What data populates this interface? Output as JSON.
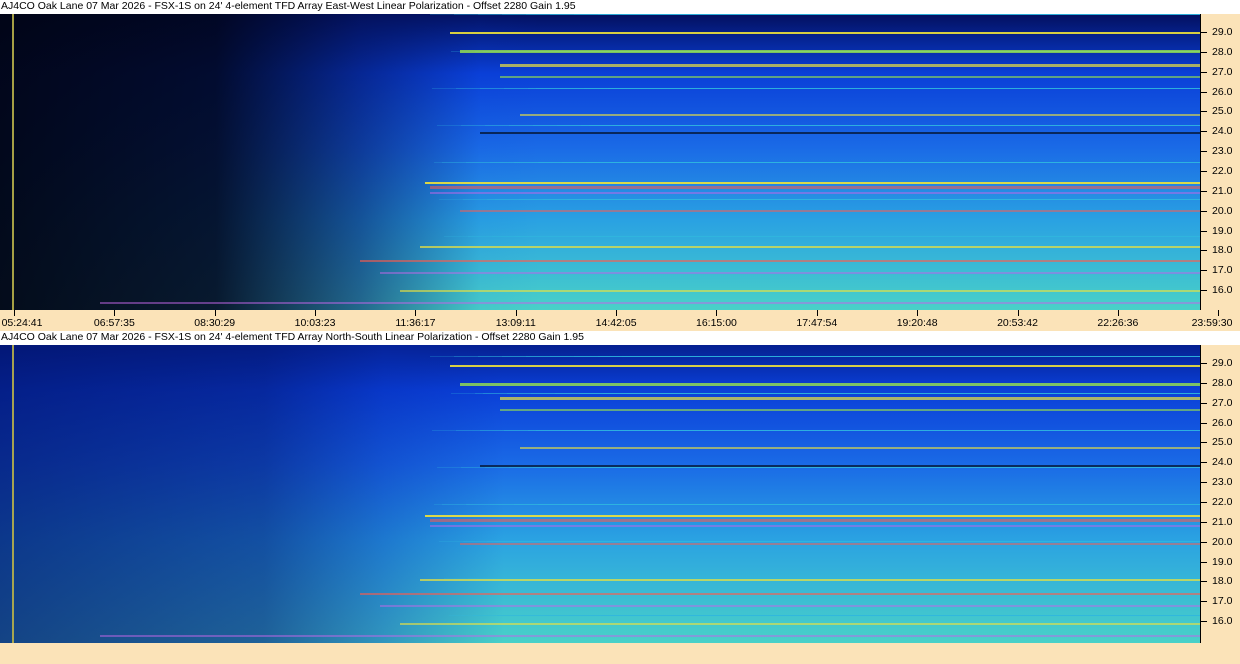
{
  "panels": [
    {
      "title": "AJ4CO Oak Lane 07 Mar 2026 - FSX-1S on 24' 4-element TFD Array East-West Linear Polarization  -  Offset 2280  Gain 1.95",
      "freq_labels": [
        "29.0",
        "28.0",
        "27.0",
        "26.0",
        "25.0",
        "24.0",
        "23.0",
        "22.0",
        "21.0",
        "20.0",
        "19.0",
        "18.0",
        "17.0",
        "16.0"
      ]
    },
    {
      "title": "AJ4CO Oak Lane 07 Mar 2026 - FSX-1S on 24' 4-element TFD Array North-South Linear Polarization  -  Offset 2280  Gain 1.95",
      "freq_labels": [
        "29.0",
        "28.0",
        "27.0",
        "26.0",
        "25.0",
        "24.0",
        "23.0",
        "22.0",
        "21.0",
        "20.0",
        "19.0",
        "18.0",
        "17.0",
        "16.0"
      ]
    }
  ],
  "time_labels": [
    "05:24:41",
    "06:57:35",
    "08:30:29",
    "10:03:23",
    "11:36:17",
    "13:09:11",
    "14:42:05",
    "16:15:00",
    "17:47:54",
    "19:20:48",
    "20:53:42",
    "22:26:36",
    "23:59:30"
  ],
  "colors": {
    "axis_background": "#fbe3b8",
    "spectrum_dark": "#02081e",
    "spectrum_blue": "#0a3fd8",
    "spectrum_cyan": "#2fb8e0",
    "band_green": "#9ae34a",
    "band_yellow": "#f0e23a",
    "band_red": "#ff5a4a",
    "band_magenta": "#c266e8",
    "marker_line": "#b7b04a"
  }
}
